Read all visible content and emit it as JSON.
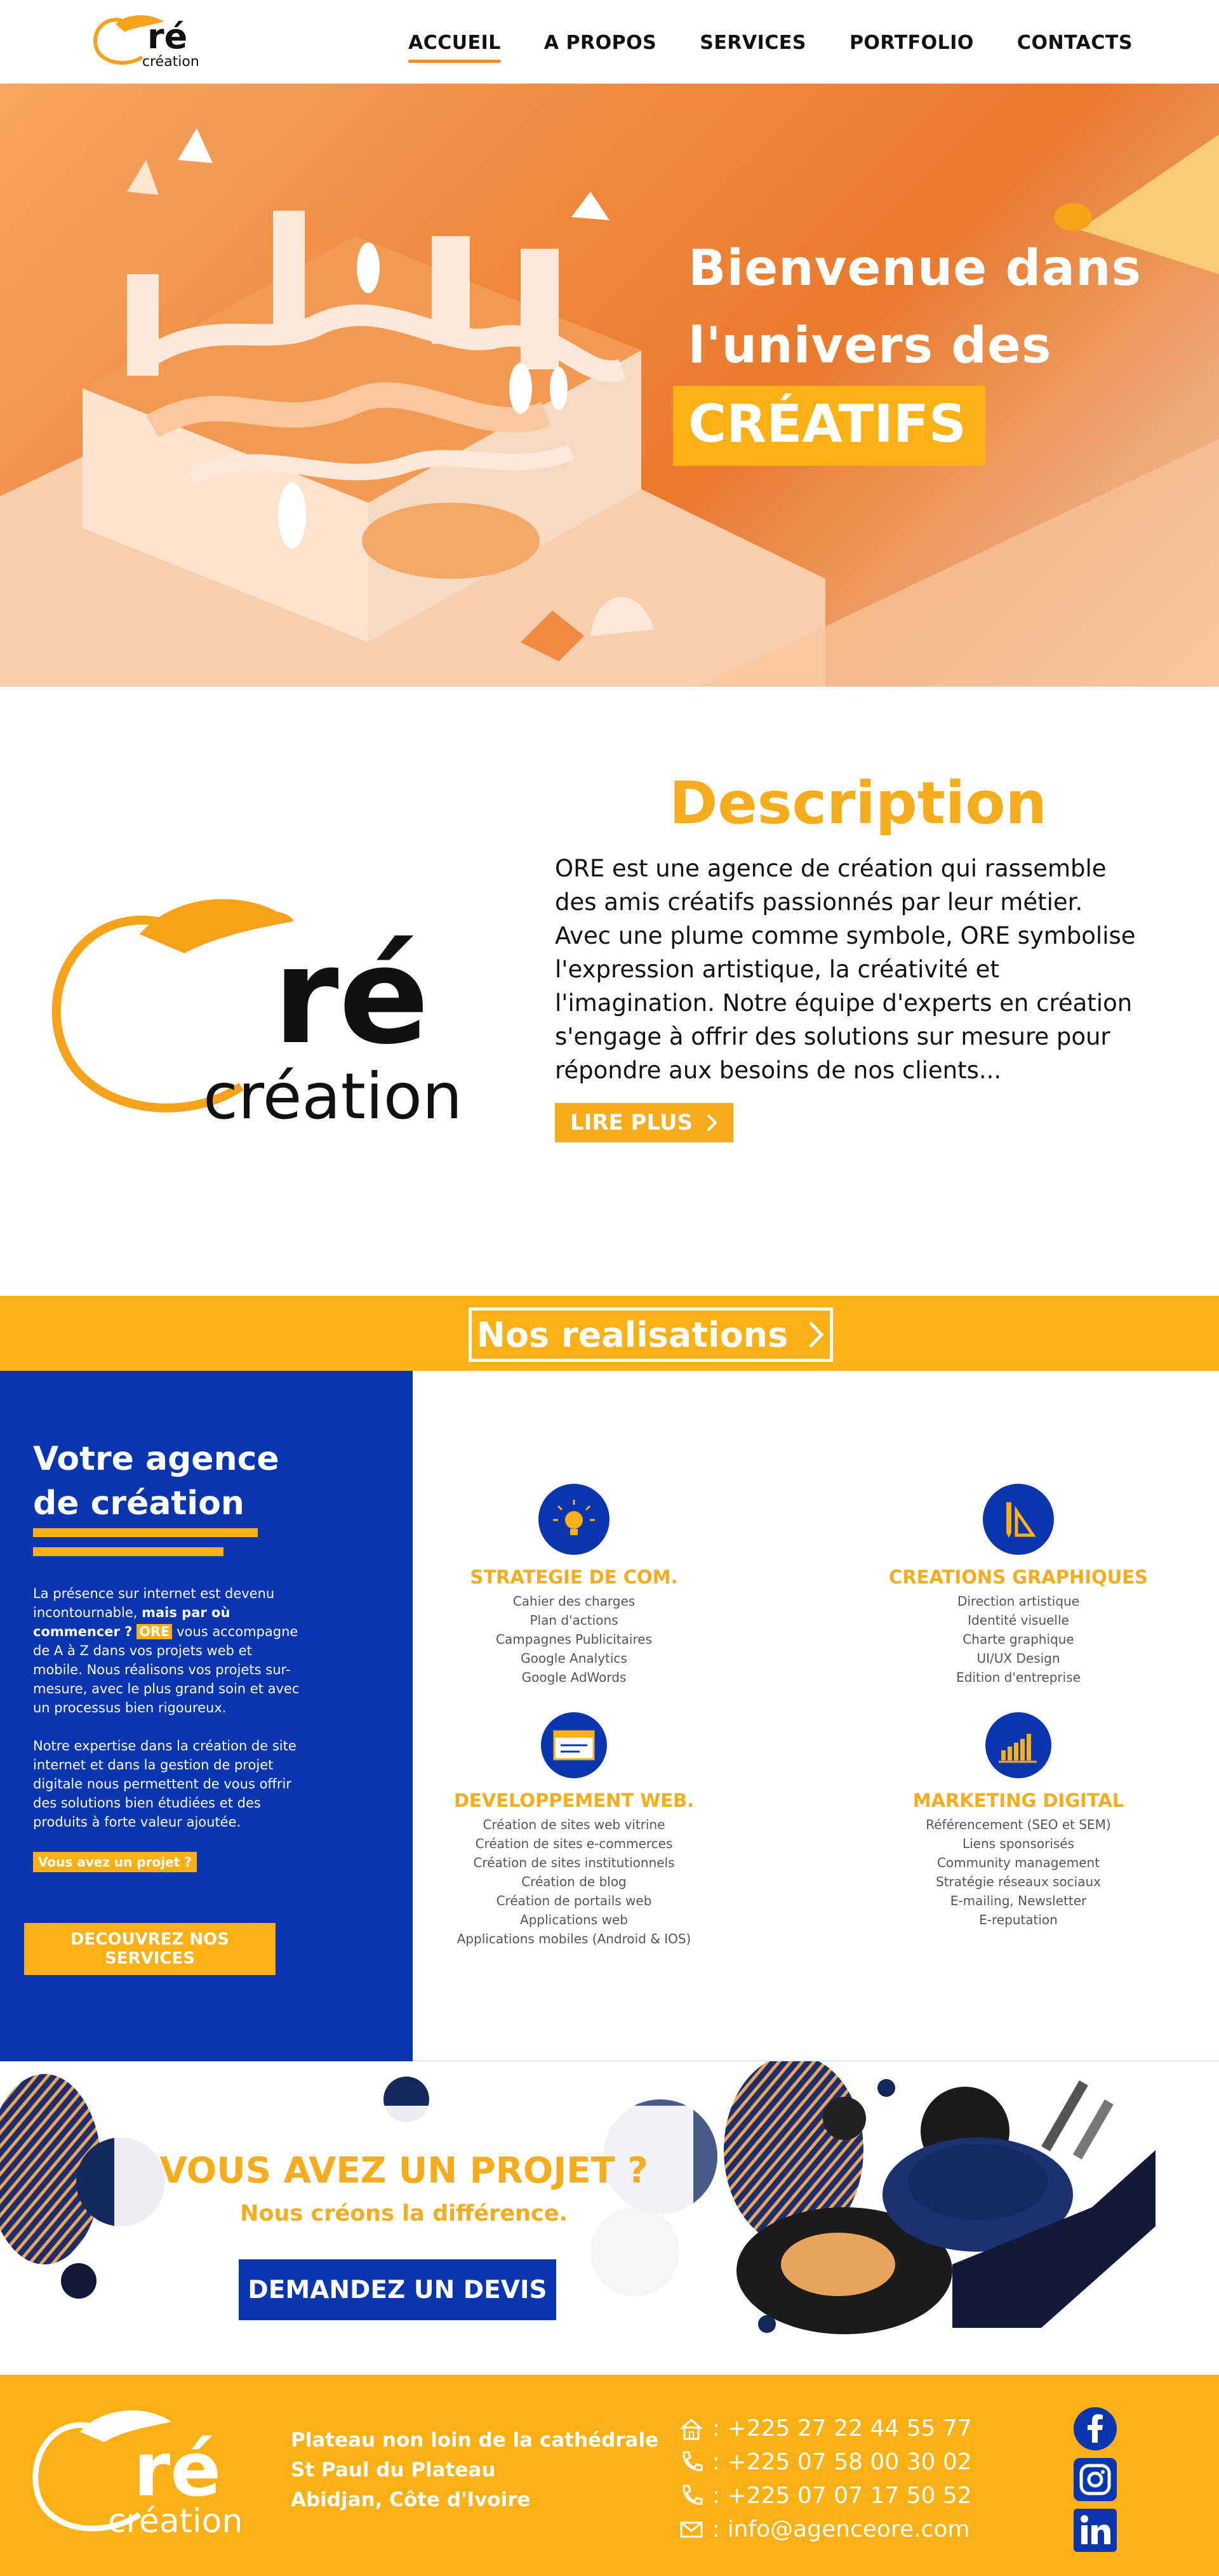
{
  "nav": {
    "logo_text": "ré",
    "logo_sub": "création",
    "items": [
      "ACCUEIL",
      "A PROPOS",
      "SERVICES",
      "PORTFOLIO",
      "CONTACTS"
    ]
  },
  "hero": {
    "line1": "Bienvenue dans",
    "line2": "l'univers des",
    "highlight": "CRÉATIFS"
  },
  "description": {
    "title": "Description",
    "text": "ORE est une agence de création qui rassemble des amis créatifs passionnés par leur métier. Avec une plume comme symbole, ORE symbolise l'expression artistique, la créativité et l'imagination. Notre équipe d'experts en création s'engage à offrir des solutions sur mesure pour répondre aux besoins de nos clients...",
    "read_more": "LIRE PLUS"
  },
  "realisations": {
    "label": "Nos realisations"
  },
  "agency": {
    "title_line1": "Votre agence",
    "title_line2": "de création",
    "p1_a": "La présence sur internet est devenu incontournable, ",
    "p1_b": "mais par où commencer ?",
    "p1_hl": "ORE",
    "p1_c": " vous accompagne de A à Z dans vos projets web et mobile. Nous réalisons vos projets sur-mesure, avec le plus grand soin et avec un processus bien rigoureux.",
    "p2": "Notre expertise dans la création de site internet et dans la gestion de projet digitale nous permettent de vous offrir des solutions bien étudiées et des produits à forte valeur ajoutée.",
    "cta": "Vous avez un projet ?",
    "button": "DECOUVREZ NOS SERVICES"
  },
  "services": [
    {
      "title": "STRATEGIE DE COM.",
      "icon": "lightbulb-icon",
      "items": [
        "Cahier des charges",
        "Plan d'actions",
        "Campagnes Publicitaires",
        "Google Analytics",
        "Google AdWords"
      ]
    },
    {
      "title": "CREATIONS GRAPHIQUES",
      "icon": "design-tools-icon",
      "items": [
        "Direction artistique",
        "Identité visuelle",
        "Charte graphique",
        "UI/UX Design",
        "Edition d'entreprise"
      ]
    },
    {
      "title": "DEVELOPPEMENT WEB.",
      "icon": "browser-window-icon",
      "items": [
        "Création de sites web vitrine",
        "Création de sites e-commerces",
        "Création de sites institutionnels",
        "Création de blog",
        "Création de portails web",
        "Applications web",
        "Applications mobiles (Android & IOS)"
      ]
    },
    {
      "title": "MARKETING DIGITAL",
      "icon": "bar-chart-icon",
      "items": [
        "Référencement (SEO et SEM)",
        "Liens sponsorisés",
        "Community management",
        "Stratégie réseaux sociaux",
        "E-mailing, Newsletter",
        "E-reputation"
      ]
    }
  ],
  "project": {
    "title": "VOUS AVEZ UN PROJET ?",
    "subtitle": "Nous créons la différence.",
    "button": "DEMANDEZ UN DEVIS"
  },
  "footer": {
    "address": [
      "Plateau non loin de la cathédrale",
      "St Paul du Plateau",
      "Abidjan, Côte d'Ivoire"
    ],
    "contacts": [
      {
        "icon": "home-icon",
        "text": ": +225 27 22 44 55 77"
      },
      {
        "icon": "phone-icon",
        "text": ": +225 07 58 00 30 02"
      },
      {
        "icon": "phone-icon",
        "text": ": +225 07 07 17 50 52"
      },
      {
        "icon": "mail-icon",
        "text": ": info@agenceore.com"
      }
    ],
    "socials": [
      "facebook-icon",
      "instagram-icon",
      "linkedin-icon"
    ]
  },
  "colors": {
    "accent": "#fbb116",
    "brand_blue": "#0a35b0",
    "hero_orange": "#f08a3f"
  }
}
